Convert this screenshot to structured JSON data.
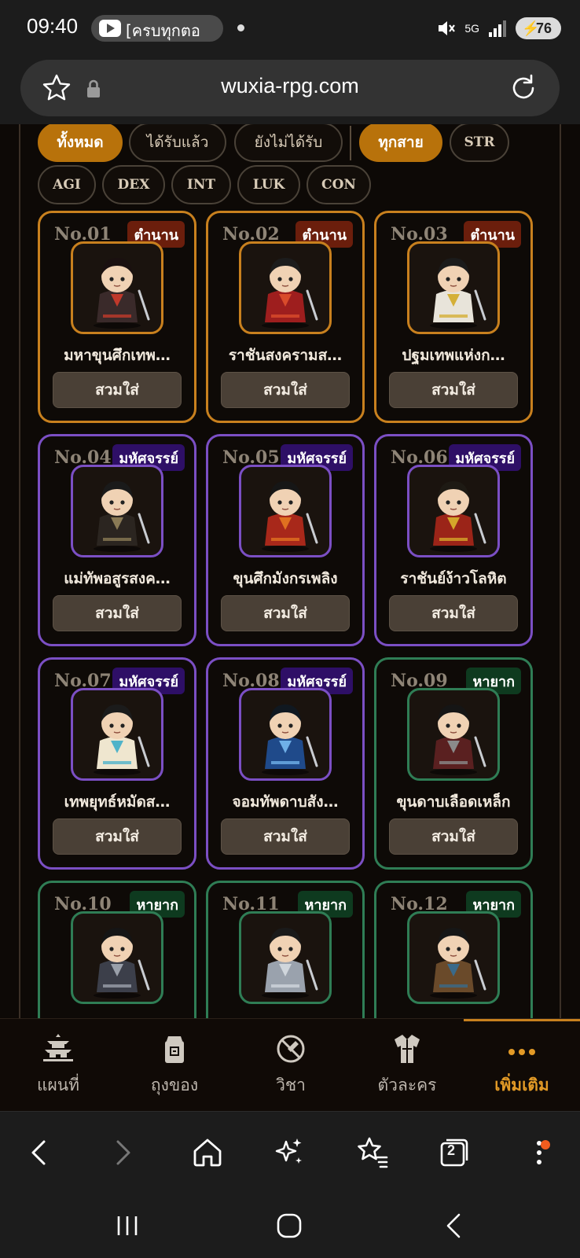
{
  "status_bar": {
    "time": "09:40",
    "media_text": "[ครบทุกตอ",
    "network": "5G",
    "battery": "76"
  },
  "browser": {
    "url": "wuxia-rpg.com",
    "tabs_count": "2"
  },
  "filters": {
    "ownership": [
      {
        "label": "ทั้งหมด",
        "active": true
      },
      {
        "label": "ได้รับแล้ว",
        "active": false
      },
      {
        "label": "ยังไม่ได้รับ",
        "active": false
      }
    ],
    "stats": [
      {
        "label": "ทุกสาย",
        "active": true
      },
      {
        "label": "STR",
        "active": false
      },
      {
        "label": "AGI",
        "active": false
      },
      {
        "label": "DEX",
        "active": false
      },
      {
        "label": "INT",
        "active": false
      },
      {
        "label": "LUK",
        "active": false
      },
      {
        "label": "CON",
        "active": false
      }
    ]
  },
  "rarity_colors": {
    "legendary": "#c8801e",
    "epic": "#7b4fc4",
    "rare": "#2f7d55"
  },
  "cards": [
    {
      "no": "No.01",
      "rarity": "ตำนาน",
      "tier": "legendary",
      "name": "มหาขุนศึกเทพ…",
      "button": "สวมใส่",
      "outfit": "#3a2a2a",
      "accent": "#c0392b",
      "hair": "#1a1010"
    },
    {
      "no": "No.02",
      "rarity": "ตำนาน",
      "tier": "legendary",
      "name": "ราชันสงครามส…",
      "button": "สวมใส่",
      "outfit": "#9e1e1e",
      "accent": "#d94b2b",
      "hair": "#1c1c1c"
    },
    {
      "no": "No.03",
      "rarity": "ตำนาน",
      "tier": "legendary",
      "name": "ปฐมเทพแห่งก…",
      "button": "สวมใส่",
      "outfit": "#e8e4da",
      "accent": "#d4af37",
      "hair": "#1b1b1b"
    },
    {
      "no": "No.04",
      "rarity": "มหัศจรรย์",
      "tier": "epic",
      "name": "แม่ทัพอสูรสงค…",
      "button": "สวมใส่",
      "outfit": "#2b2520",
      "accent": "#8a7a55",
      "hair": "#1a1a1a"
    },
    {
      "no": "No.05",
      "rarity": "มหัศจรรย์",
      "tier": "epic",
      "name": "ขุนศึกมังกรเพลิง",
      "button": "สวมใส่",
      "outfit": "#a8281a",
      "accent": "#e07020",
      "hair": "#161616"
    },
    {
      "no": "No.06",
      "rarity": "มหัศจรรย์",
      "tier": "epic",
      "name": "ราชันย์ง้าวโลหิต",
      "button": "สวมใส่",
      "outfit": "#9b2418",
      "accent": "#d4a52a",
      "hair": "#1e1a14"
    },
    {
      "no": "No.07",
      "rarity": "มหัศจรรย์",
      "tier": "epic",
      "name": "เทพยุทธ์หมัดส…",
      "button": "สวมใส่",
      "outfit": "#efe6cf",
      "accent": "#4fb3c9",
      "hair": "#1b1b1b"
    },
    {
      "no": "No.08",
      "rarity": "มหัศจรรย์",
      "tier": "epic",
      "name": "จอมทัพดาบสัง…",
      "button": "สวมใส่",
      "outfit": "#1f4a8a",
      "accent": "#6fb0e8",
      "hair": "#101820"
    },
    {
      "no": "No.09",
      "rarity": "หายาก",
      "tier": "rare",
      "name": "ขุนดาบเลือดเหล็ก",
      "button": "สวมใส่",
      "outfit": "#5a2020",
      "accent": "#8a8a8a",
      "hair": "#151515"
    },
    {
      "no": "No.10",
      "rarity": "หายาก",
      "tier": "rare",
      "name": "",
      "button": "",
      "outfit": "#3c3f4a",
      "accent": "#9aa0aa",
      "hair": "#151515"
    },
    {
      "no": "No.11",
      "rarity": "หายาก",
      "tier": "rare",
      "name": "",
      "button": "",
      "outfit": "#9aa2ad",
      "accent": "#d0d6dc",
      "hair": "#1a1a1a"
    },
    {
      "no": "No.12",
      "rarity": "หายาก",
      "tier": "rare",
      "name": "",
      "button": "",
      "outfit": "#6a4a2a",
      "accent": "#3a6a8a",
      "hair": "#161616"
    }
  ],
  "game_nav": [
    {
      "label": "แผนที่",
      "icon": "pagoda-icon",
      "active": false
    },
    {
      "label": "ถุงของ",
      "icon": "bag-icon",
      "active": false
    },
    {
      "label": "วิชา",
      "icon": "skill-icon",
      "active": false
    },
    {
      "label": "ตัวละคร",
      "icon": "robe-icon",
      "active": false
    },
    {
      "label": "เพิ่มเติม",
      "icon": "more-dots-icon",
      "active": true
    }
  ]
}
